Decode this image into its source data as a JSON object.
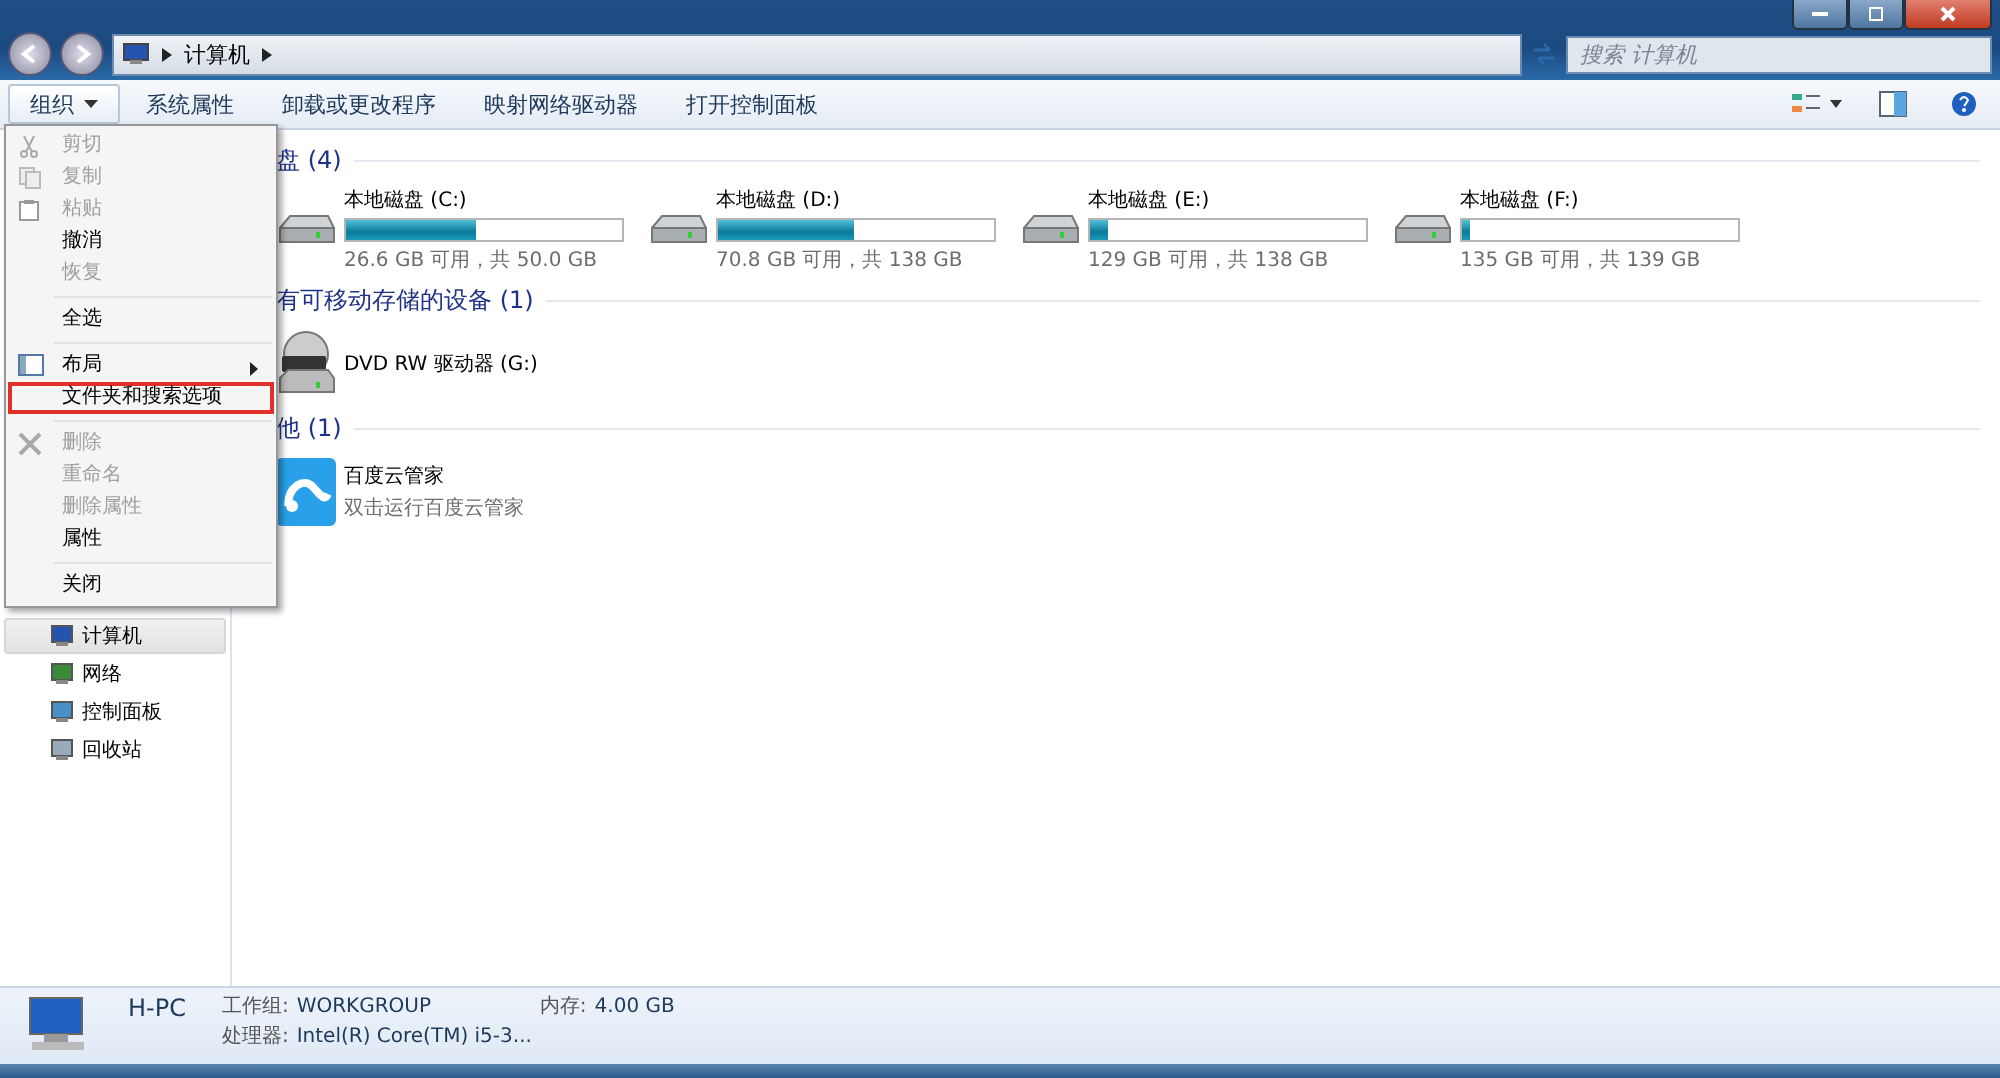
{
  "address": {
    "crumbs": [
      "计算机"
    ]
  },
  "search": {
    "placeholder": "搜索 计算机"
  },
  "toolbar": {
    "buttons": [
      {
        "label": "组织",
        "dropdown": true
      },
      {
        "label": "系统属性",
        "dropdown": false
      },
      {
        "label": "卸载或更改程序",
        "dropdown": false
      },
      {
        "label": "映射网络驱动器",
        "dropdown": false
      },
      {
        "label": "打开控制面板",
        "dropdown": false
      }
    ]
  },
  "menu": {
    "items": [
      {
        "kind": "item",
        "label": "剪切",
        "disabled": true,
        "outlined": false
      },
      {
        "kind": "item",
        "label": "复制",
        "disabled": true,
        "outlined": false
      },
      {
        "kind": "item",
        "label": "粘贴",
        "disabled": true,
        "outlined": false
      },
      {
        "kind": "item",
        "label": "撤消",
        "disabled": false,
        "outlined": false
      },
      {
        "kind": "item",
        "label": "恢复",
        "disabled": true,
        "outlined": false
      },
      {
        "kind": "separator"
      },
      {
        "kind": "item",
        "label": "全选",
        "disabled": false,
        "outlined": false
      },
      {
        "kind": "separator"
      },
      {
        "kind": "submenu",
        "label": "布局",
        "disabled": false,
        "outlined": false
      },
      {
        "kind": "item",
        "label": "文件夹和搜索选项",
        "disabled": false,
        "outlined": true
      },
      {
        "kind": "separator"
      },
      {
        "kind": "item",
        "label": "删除",
        "disabled": true,
        "outlined": false
      },
      {
        "kind": "item",
        "label": "重命名",
        "disabled": true,
        "outlined": false
      },
      {
        "kind": "item",
        "label": "删除属性",
        "disabled": true,
        "outlined": false
      },
      {
        "kind": "item",
        "label": "属性",
        "disabled": false,
        "outlined": false
      },
      {
        "kind": "separator"
      },
      {
        "kind": "item",
        "label": "关闭",
        "disabled": false,
        "outlined": false
      }
    ]
  },
  "sidebar": {
    "items": [
      {
        "label": "计算机",
        "selected": true
      },
      {
        "label": "网络",
        "selected": false
      },
      {
        "label": "控制面板",
        "selected": false
      },
      {
        "label": "回收站",
        "selected": false
      }
    ]
  },
  "groups": [
    {
      "title": "盘 (4)",
      "items": [
        {
          "kind": "drive",
          "name": "本地磁盘 (C:)",
          "free": "26.6 GB 可用，共 50.0 GB",
          "level": 0.47
        },
        {
          "kind": "drive",
          "name": "本地磁盘 (D:)",
          "free": "70.8 GB 可用，共 138 GB",
          "level": 0.49
        },
        {
          "kind": "drive",
          "name": "本地磁盘 (E:)",
          "free": "129 GB 可用，共 138 GB",
          "level": 0.065
        },
        {
          "kind": "drive",
          "name": "本地磁盘 (F:)",
          "free": "135 GB 可用，共 139 GB",
          "level": 0.03
        }
      ]
    },
    {
      "title": "有可移动存储的设备 (1)",
      "items": [
        {
          "kind": "dvd",
          "name": "DVD RW 驱动器 (G:)"
        }
      ]
    },
    {
      "title": "他 (1)",
      "items": [
        {
          "kind": "app",
          "name": "百度云管家",
          "subtitle": "双击运行百度云管家"
        }
      ]
    }
  ],
  "details": {
    "name": "H-PC",
    "fields": [
      {
        "label": "工作组:",
        "value": "WORKGROUP"
      },
      {
        "label": "内存:",
        "value": "4.00 GB"
      },
      {
        "label": "处理器:",
        "value": "Intel(R) Core(TM) i5-3..."
      }
    ]
  }
}
